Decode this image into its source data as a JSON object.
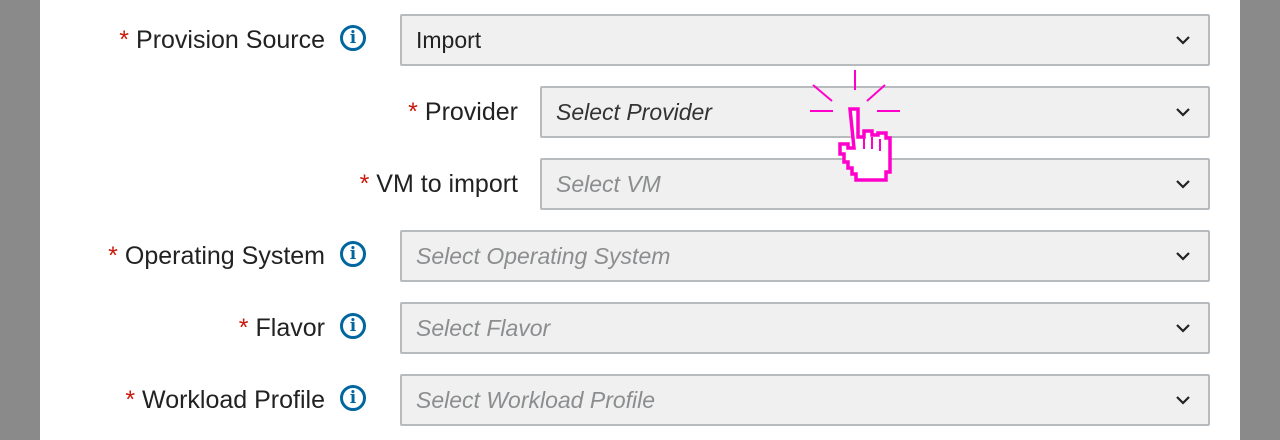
{
  "form": {
    "provision_source": {
      "label": "Provision Source",
      "required_mark": "*",
      "value": "Import"
    },
    "provider": {
      "label": "Provider",
      "required_mark": "*",
      "placeholder": "Select Provider"
    },
    "vm_to_import": {
      "label": "VM to import",
      "required_mark": "*",
      "placeholder": "Select VM"
    },
    "operating_system": {
      "label": "Operating System",
      "required_mark": "*",
      "placeholder": "Select Operating System"
    },
    "flavor": {
      "label": "Flavor",
      "required_mark": "*",
      "placeholder": "Select Flavor"
    },
    "workload_profile": {
      "label": "Workload Profile",
      "required_mark": "*",
      "placeholder": "Select Workload Profile"
    }
  },
  "icons": {
    "info": "info-icon",
    "chevron": "chevron-down-icon",
    "cursor": "hand-pointer-icon"
  },
  "colors": {
    "required": "#c9190b",
    "info": "#0066a0",
    "cursor": "#ff00cc"
  }
}
